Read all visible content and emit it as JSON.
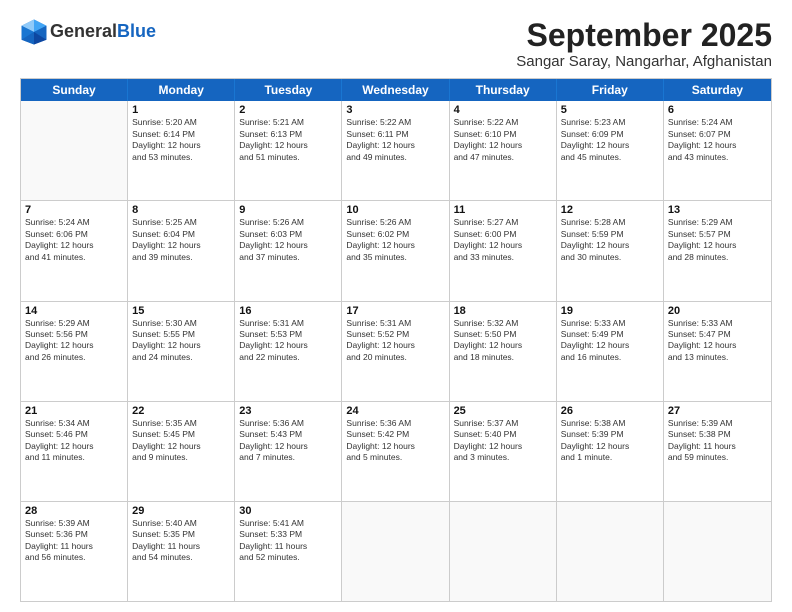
{
  "header": {
    "logo_general": "General",
    "logo_blue": "Blue",
    "month": "September 2025",
    "location": "Sangar Saray, Nangarhar, Afghanistan"
  },
  "weekdays": [
    "Sunday",
    "Monday",
    "Tuesday",
    "Wednesday",
    "Thursday",
    "Friday",
    "Saturday"
  ],
  "rows": [
    [
      {
        "day": "",
        "text": ""
      },
      {
        "day": "1",
        "text": "Sunrise: 5:20 AM\nSunset: 6:14 PM\nDaylight: 12 hours\nand 53 minutes."
      },
      {
        "day": "2",
        "text": "Sunrise: 5:21 AM\nSunset: 6:13 PM\nDaylight: 12 hours\nand 51 minutes."
      },
      {
        "day": "3",
        "text": "Sunrise: 5:22 AM\nSunset: 6:11 PM\nDaylight: 12 hours\nand 49 minutes."
      },
      {
        "day": "4",
        "text": "Sunrise: 5:22 AM\nSunset: 6:10 PM\nDaylight: 12 hours\nand 47 minutes."
      },
      {
        "day": "5",
        "text": "Sunrise: 5:23 AM\nSunset: 6:09 PM\nDaylight: 12 hours\nand 45 minutes."
      },
      {
        "day": "6",
        "text": "Sunrise: 5:24 AM\nSunset: 6:07 PM\nDaylight: 12 hours\nand 43 minutes."
      }
    ],
    [
      {
        "day": "7",
        "text": "Sunrise: 5:24 AM\nSunset: 6:06 PM\nDaylight: 12 hours\nand 41 minutes."
      },
      {
        "day": "8",
        "text": "Sunrise: 5:25 AM\nSunset: 6:04 PM\nDaylight: 12 hours\nand 39 minutes."
      },
      {
        "day": "9",
        "text": "Sunrise: 5:26 AM\nSunset: 6:03 PM\nDaylight: 12 hours\nand 37 minutes."
      },
      {
        "day": "10",
        "text": "Sunrise: 5:26 AM\nSunset: 6:02 PM\nDaylight: 12 hours\nand 35 minutes."
      },
      {
        "day": "11",
        "text": "Sunrise: 5:27 AM\nSunset: 6:00 PM\nDaylight: 12 hours\nand 33 minutes."
      },
      {
        "day": "12",
        "text": "Sunrise: 5:28 AM\nSunset: 5:59 PM\nDaylight: 12 hours\nand 30 minutes."
      },
      {
        "day": "13",
        "text": "Sunrise: 5:29 AM\nSunset: 5:57 PM\nDaylight: 12 hours\nand 28 minutes."
      }
    ],
    [
      {
        "day": "14",
        "text": "Sunrise: 5:29 AM\nSunset: 5:56 PM\nDaylight: 12 hours\nand 26 minutes."
      },
      {
        "day": "15",
        "text": "Sunrise: 5:30 AM\nSunset: 5:55 PM\nDaylight: 12 hours\nand 24 minutes."
      },
      {
        "day": "16",
        "text": "Sunrise: 5:31 AM\nSunset: 5:53 PM\nDaylight: 12 hours\nand 22 minutes."
      },
      {
        "day": "17",
        "text": "Sunrise: 5:31 AM\nSunset: 5:52 PM\nDaylight: 12 hours\nand 20 minutes."
      },
      {
        "day": "18",
        "text": "Sunrise: 5:32 AM\nSunset: 5:50 PM\nDaylight: 12 hours\nand 18 minutes."
      },
      {
        "day": "19",
        "text": "Sunrise: 5:33 AM\nSunset: 5:49 PM\nDaylight: 12 hours\nand 16 minutes."
      },
      {
        "day": "20",
        "text": "Sunrise: 5:33 AM\nSunset: 5:47 PM\nDaylight: 12 hours\nand 13 minutes."
      }
    ],
    [
      {
        "day": "21",
        "text": "Sunrise: 5:34 AM\nSunset: 5:46 PM\nDaylight: 12 hours\nand 11 minutes."
      },
      {
        "day": "22",
        "text": "Sunrise: 5:35 AM\nSunset: 5:45 PM\nDaylight: 12 hours\nand 9 minutes."
      },
      {
        "day": "23",
        "text": "Sunrise: 5:36 AM\nSunset: 5:43 PM\nDaylight: 12 hours\nand 7 minutes."
      },
      {
        "day": "24",
        "text": "Sunrise: 5:36 AM\nSunset: 5:42 PM\nDaylight: 12 hours\nand 5 minutes."
      },
      {
        "day": "25",
        "text": "Sunrise: 5:37 AM\nSunset: 5:40 PM\nDaylight: 12 hours\nand 3 minutes."
      },
      {
        "day": "26",
        "text": "Sunrise: 5:38 AM\nSunset: 5:39 PM\nDaylight: 12 hours\nand 1 minute."
      },
      {
        "day": "27",
        "text": "Sunrise: 5:39 AM\nSunset: 5:38 PM\nDaylight: 11 hours\nand 59 minutes."
      }
    ],
    [
      {
        "day": "28",
        "text": "Sunrise: 5:39 AM\nSunset: 5:36 PM\nDaylight: 11 hours\nand 56 minutes."
      },
      {
        "day": "29",
        "text": "Sunrise: 5:40 AM\nSunset: 5:35 PM\nDaylight: 11 hours\nand 54 minutes."
      },
      {
        "day": "30",
        "text": "Sunrise: 5:41 AM\nSunset: 5:33 PM\nDaylight: 11 hours\nand 52 minutes."
      },
      {
        "day": "",
        "text": ""
      },
      {
        "day": "",
        "text": ""
      },
      {
        "day": "",
        "text": ""
      },
      {
        "day": "",
        "text": ""
      }
    ]
  ]
}
